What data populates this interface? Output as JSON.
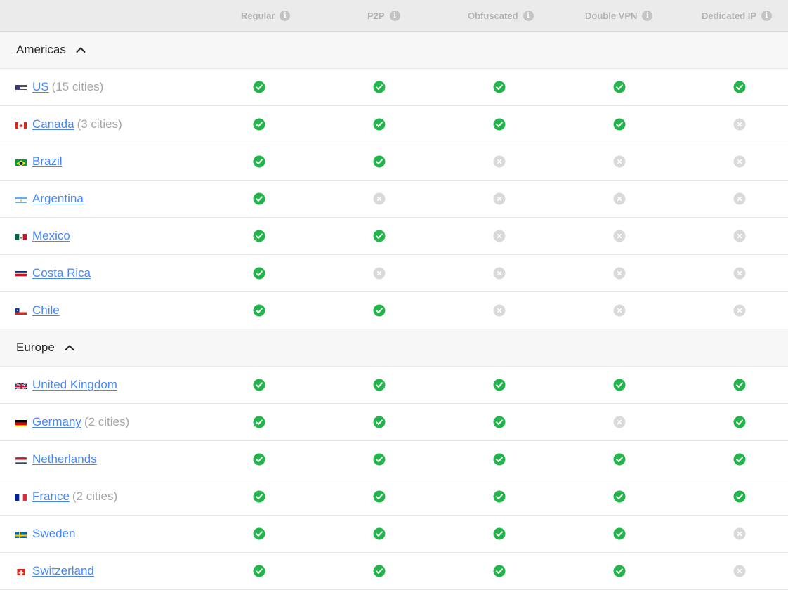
{
  "columns": [
    {
      "label": "Regular",
      "center": 0
    },
    {
      "label": "P2P",
      "center": 0
    },
    {
      "label": "Obfuscated",
      "center": 0
    },
    {
      "label": "Double VPN",
      "center": 0
    },
    {
      "label": "Dedicated IP",
      "center": 0
    }
  ],
  "colors": {
    "check": "#22b54b",
    "cross": "#d9d9d9",
    "link": "#4687ff"
  },
  "regions": [
    {
      "name": "Americas",
      "icon": "chevron-up-icon",
      "countries": [
        {
          "name": "US",
          "cities": "(15 cities)",
          "flag": "us",
          "support": [
            true,
            true,
            true,
            true,
            true
          ]
        },
        {
          "name": "Canada",
          "cities": "(3 cities)",
          "flag": "ca",
          "support": [
            true,
            true,
            true,
            true,
            false
          ]
        },
        {
          "name": "Brazil",
          "cities": "",
          "flag": "br",
          "support": [
            true,
            true,
            false,
            false,
            false
          ]
        },
        {
          "name": "Argentina",
          "cities": "",
          "flag": "ar",
          "support": [
            true,
            false,
            false,
            false,
            false
          ]
        },
        {
          "name": "Mexico",
          "cities": "",
          "flag": "mx",
          "support": [
            true,
            true,
            false,
            false,
            false
          ]
        },
        {
          "name": "Costa Rica",
          "cities": "",
          "flag": "cr",
          "support": [
            true,
            false,
            false,
            false,
            false
          ]
        },
        {
          "name": "Chile",
          "cities": "",
          "flag": "cl",
          "support": [
            true,
            true,
            false,
            false,
            false
          ]
        }
      ]
    },
    {
      "name": "Europe",
      "icon": "chevron-up-icon",
      "countries": [
        {
          "name": "United Kingdom",
          "cities": "",
          "flag": "gb",
          "support": [
            true,
            true,
            true,
            true,
            true
          ]
        },
        {
          "name": "Germany",
          "cities": "(2 cities)",
          "flag": "de",
          "support": [
            true,
            true,
            true,
            false,
            true
          ]
        },
        {
          "name": "Netherlands",
          "cities": "",
          "flag": "nl",
          "support": [
            true,
            true,
            true,
            true,
            true
          ]
        },
        {
          "name": "France",
          "cities": "(2 cities)",
          "flag": "fr",
          "support": [
            true,
            true,
            true,
            true,
            true
          ]
        },
        {
          "name": "Sweden",
          "cities": "",
          "flag": "se",
          "support": [
            true,
            true,
            true,
            true,
            false
          ]
        },
        {
          "name": "Switzerland",
          "cities": "",
          "flag": "ch",
          "support": [
            true,
            true,
            true,
            true,
            false
          ]
        }
      ]
    }
  ]
}
